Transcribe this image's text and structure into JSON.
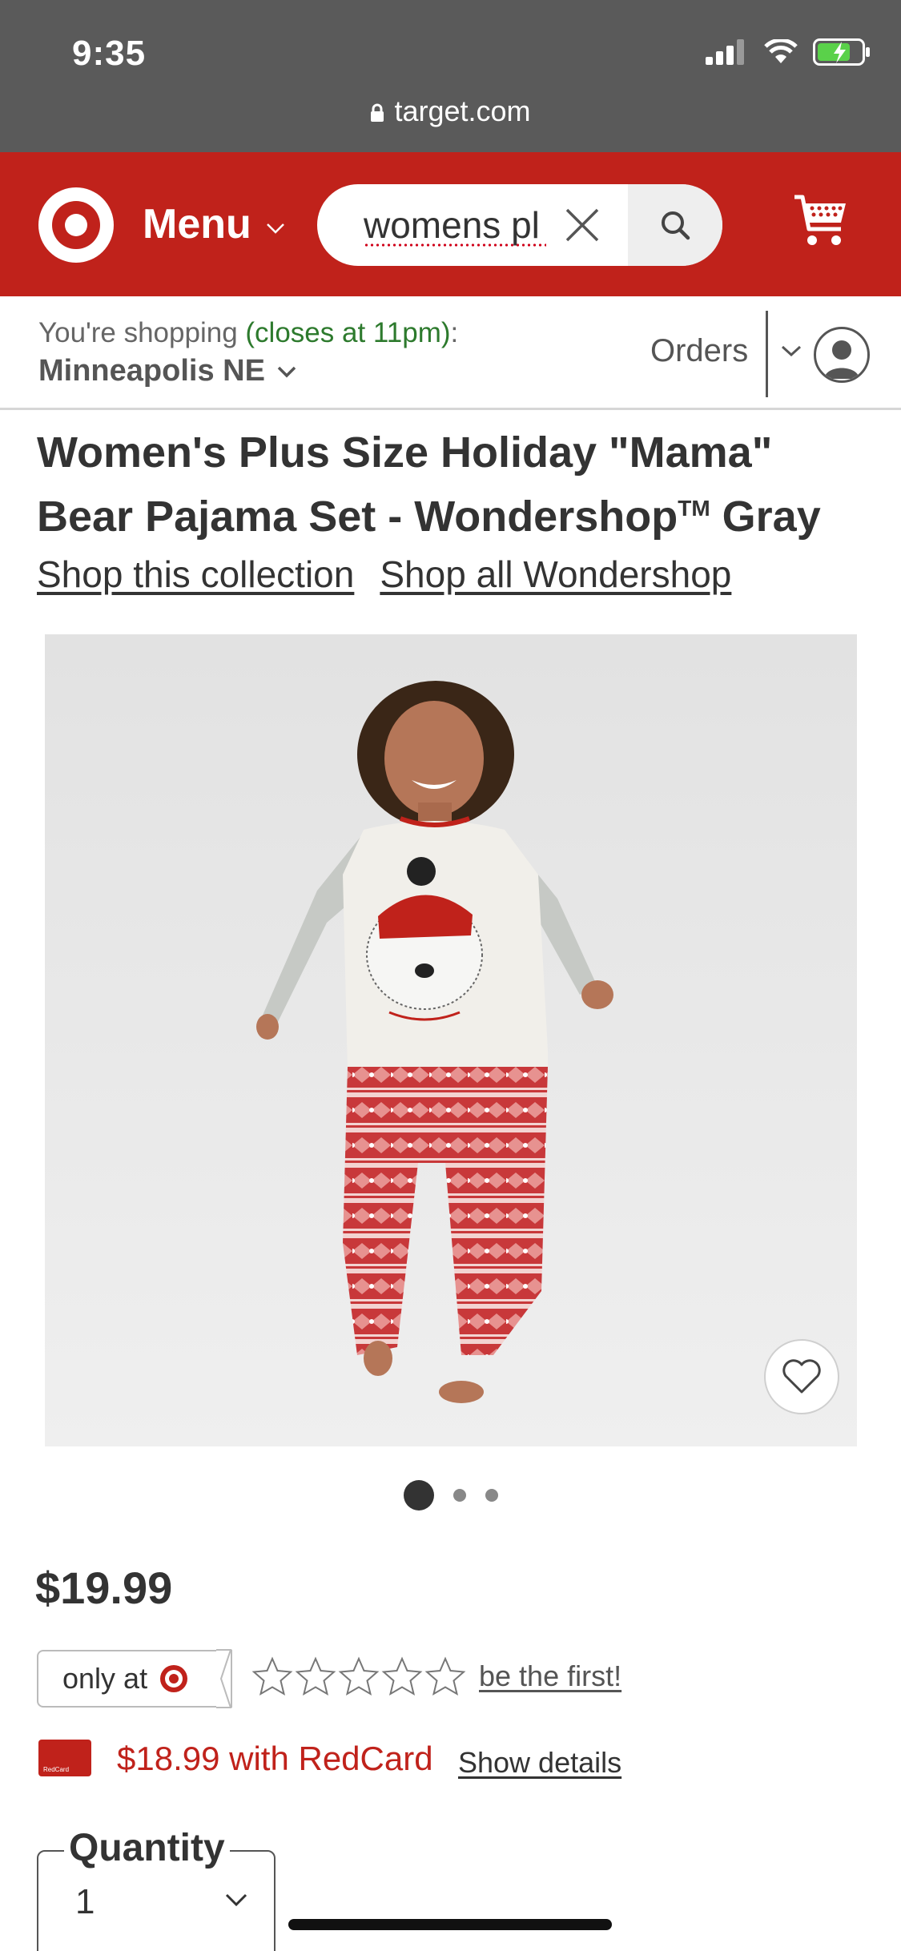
{
  "status": {
    "time": "9:35",
    "url": "target.com"
  },
  "header": {
    "menu_label": "Menu",
    "search_value": "womens pl",
    "brand_color": "#c0221b"
  },
  "store": {
    "shopping_prefix": "You're shopping ",
    "hours": "(closes at 11pm)",
    "shopping_suffix": ":",
    "store_name": "Minneapolis NE",
    "orders_label": "Orders"
  },
  "product": {
    "title_line1": "Women's Plus Size Holiday \"Mama\"",
    "title_line2_part1": "Bear Pajama Set - Wondershop",
    "trademark": "TM",
    "title_line2_part2": " Gray",
    "link_collection": "Shop this collection",
    "link_brand": "Shop all Wondershop",
    "image_count": 3,
    "active_image": 1,
    "price": "$19.99",
    "only_at": "only at",
    "rating_stars": 0,
    "rating_max": 5,
    "review_link": "be the first!",
    "redcard_price": "$18.99 with RedCard",
    "redcard_badge": "RedCard",
    "show_details": "Show details",
    "quantity_label": "Quantity",
    "quantity_value": "1"
  }
}
